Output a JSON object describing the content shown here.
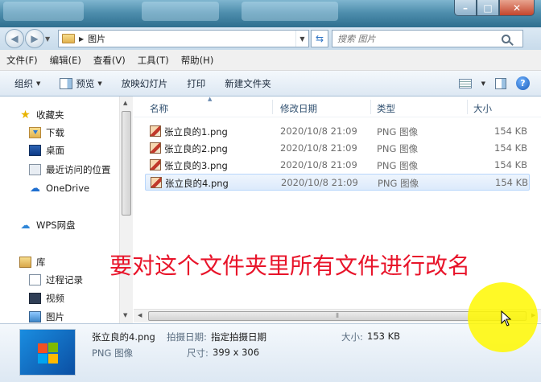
{
  "window": {
    "controls": {
      "minimize": "–",
      "maximize": "□",
      "close": "✕"
    }
  },
  "address": {
    "path": "图片",
    "search_placeholder": "搜索 图片"
  },
  "menu": [
    "文件(F)",
    "编辑(E)",
    "查看(V)",
    "工具(T)",
    "帮助(H)"
  ],
  "toolbar": {
    "organize": "组织",
    "preview": "预览",
    "slideshow": "放映幻灯片",
    "print": "打印",
    "new_folder": "新建文件夹"
  },
  "nav": {
    "favorites": "收藏夹",
    "downloads": "下载",
    "desktop": "桌面",
    "recent": "最近访问的位置",
    "onedrive": "OneDrive",
    "wps": "WPS网盘",
    "library": "库",
    "history": "过程记录",
    "videos": "视频",
    "pictures": "图片"
  },
  "columns": {
    "name": "名称",
    "date": "修改日期",
    "type": "类型",
    "size": "大小"
  },
  "files": [
    {
      "name": "张立良的1.png",
      "date": "2020/10/8 21:09",
      "type": "PNG 图像",
      "size": "154 KB"
    },
    {
      "name": "张立良的2.png",
      "date": "2020/10/8 21:09",
      "type": "PNG 图像",
      "size": "154 KB"
    },
    {
      "name": "张立良的3.png",
      "date": "2020/10/8 21:09",
      "type": "PNG 图像",
      "size": "154 KB"
    },
    {
      "name": "张立良的4.png",
      "date": "2020/10/8 21:09",
      "type": "PNG 图像",
      "size": "154 KB"
    }
  ],
  "details": {
    "file_name": "张立良的4.png",
    "file_type": "PNG 图像",
    "date_label": "拍摄日期:",
    "date_value": "指定拍摄日期",
    "dims_label": "尺寸:",
    "dims_value": "399 x 306",
    "size_label": "大小:",
    "size_value": "153 KB"
  },
  "caption": "要对这个文件夹里所有文件进行改名",
  "colors": {
    "caption": "#e8142a",
    "spotlight": "#fff800",
    "selected_row": "#dceafb"
  }
}
